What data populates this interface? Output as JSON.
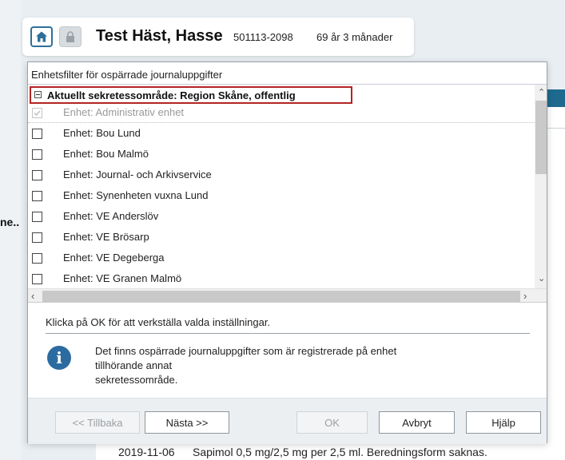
{
  "background": {
    "truncated_label": "ne..",
    "row_date": "2019-11-06",
    "row_text": "Sapimol 0,5 mg/2,5 mg per 2,5 ml. Beredningsform saknas."
  },
  "patient": {
    "name": "Test Häst, Hasse",
    "id": "501113-2098",
    "age": "69 år 3 månader",
    "home_icon": "home-icon",
    "lock_icon": "lock-icon"
  },
  "dialog": {
    "title": "Enhetsfilter för ospärrade journaluppgifter",
    "group_label": "Aktuellt sekretessområde: Region Skåne, offentlig",
    "units": [
      {
        "label": "Enhet: Administrativ enhet",
        "checked": true,
        "disabled": true
      },
      {
        "label": "Enhet: Bou Lund",
        "checked": false,
        "disabled": false
      },
      {
        "label": "Enhet: Bou Malmö",
        "checked": false,
        "disabled": false
      },
      {
        "label": "Enhet: Journal- och Arkivservice",
        "checked": false,
        "disabled": false
      },
      {
        "label": "Enhet: Synenheten vuxna Lund",
        "checked": false,
        "disabled": false
      },
      {
        "label": "Enhet: VE Anderslöv",
        "checked": false,
        "disabled": false
      },
      {
        "label": "Enhet: VE Brösarp",
        "checked": false,
        "disabled": false
      },
      {
        "label": "Enhet: VE Degeberga",
        "checked": false,
        "disabled": false
      },
      {
        "label": "Enhet: VE Granen Malmö",
        "checked": false,
        "disabled": false
      }
    ],
    "instruction": "Klicka på OK för att verkställa valda inställningar.",
    "info_lines": [
      "Det finns ospärrade journaluppgifter som är registrerade på enhet",
      "tillhörande annat",
      "sekretessområde."
    ],
    "buttons": {
      "back": "<< Tillbaka",
      "next": "Nästa >>",
      "ok": "OK",
      "cancel": "Avbryt",
      "help": "Hjälp"
    }
  },
  "colors": {
    "accent": "#2c6ba0",
    "highlight_border": "#b32424"
  }
}
